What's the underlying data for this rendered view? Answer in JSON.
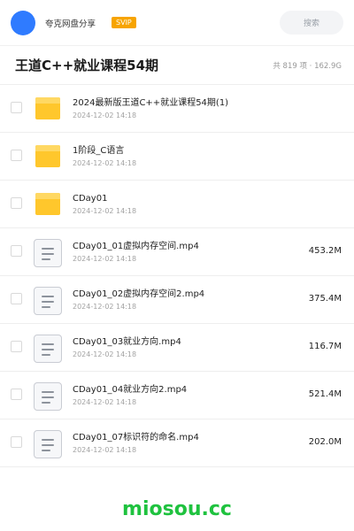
{
  "app": {
    "name": "夸克网盘分享",
    "badge": "SVIP",
    "search_placeholder": "搜索"
  },
  "header": {
    "title": "王道C++就业课程54期",
    "stats": "共 819 项 · 162.9G"
  },
  "items": [
    {
      "type": "folder",
      "name": "2024最新版王道C++就业课程54期(1)",
      "date": "2024-12-02 14:18",
      "size": ""
    },
    {
      "type": "folder",
      "name": "1阶段_C语言",
      "date": "2024-12-02 14:18",
      "size": ""
    },
    {
      "type": "folder",
      "name": "CDay01",
      "date": "2024-12-02 14:18",
      "size": ""
    },
    {
      "type": "file",
      "name": "CDay01_01虚拟内存空间.mp4",
      "date": "2024-12-02 14:18",
      "size": "453.2M"
    },
    {
      "type": "file",
      "name": "CDay01_02虚拟内存空间2.mp4",
      "date": "2024-12-02 14:18",
      "size": "375.4M"
    },
    {
      "type": "file",
      "name": "CDay01_03就业方向.mp4",
      "date": "2024-12-02 14:18",
      "size": "116.7M"
    },
    {
      "type": "file",
      "name": "CDay01_04就业方向2.mp4",
      "date": "2024-12-02 14:18",
      "size": "521.4M"
    },
    {
      "type": "file",
      "name": "CDay01_07标识符的命名.mp4",
      "date": "2024-12-02 14:18",
      "size": "202.0M"
    }
  ],
  "watermark": "miosou.cc",
  "colors": {
    "avatar": "#2f7bff",
    "svip_badge": "#f7a400",
    "folder": "#ffc72c",
    "watermark": "#1fc23f"
  },
  "icons": {
    "folder": "folder-icon",
    "file": "video-file-icon"
  }
}
